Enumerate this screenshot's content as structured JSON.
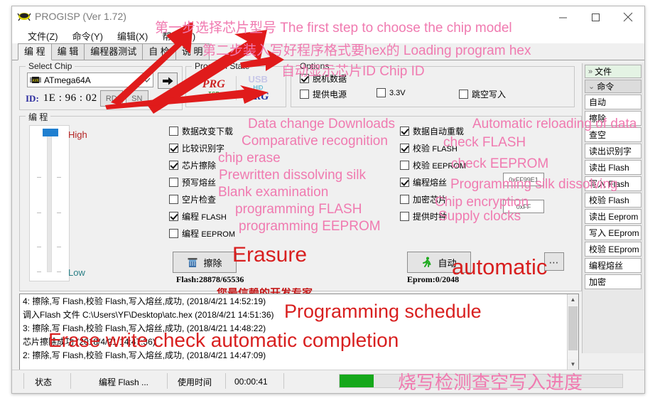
{
  "window": {
    "title": "PROGISP (Ver 1.72)",
    "minimize": "─",
    "maximize": "□",
    "close": "✕"
  },
  "menu": [
    "文件(Z)",
    "命令(Y)",
    "编辑(X)",
    "帮助(W)"
  ],
  "tabs": [
    {
      "label": "编  程",
      "active": true
    },
    {
      "label": "编  辑",
      "active": false
    },
    {
      "label": "编程器测试",
      "active": false
    },
    {
      "label": "自  检",
      "active": false
    },
    {
      "label": "说  明",
      "active": false
    }
  ],
  "select_chip": {
    "caption": "Select Chip",
    "chip": "ATmega64A",
    "dropdown_arrow": "⌄",
    "go_arrow": "➜",
    "id_label": "ID:",
    "id_value": "1E : 96 : 02",
    "rd_button": "RD",
    "sn_button": "SN"
  },
  "program_state": {
    "caption": "Program State",
    "left_main": "PRG",
    "left_sub": "ISP",
    "right_top": "USB",
    "right_mid": "HID",
    "right_main": "PRG"
  },
  "options": {
    "caption": "Options",
    "items": [
      {
        "label": "脱机数据",
        "checked": true
      },
      {
        "label": "提供电源",
        "checked": false
      },
      {
        "label": "3.3V",
        "checked": false
      },
      {
        "label": "跳空写入",
        "checked": false
      }
    ]
  },
  "programming": {
    "caption": "编  程",
    "slider_high": "High",
    "slider_low": "Low",
    "left_options": [
      {
        "label": "数据改变下载",
        "checked": false
      },
      {
        "label": "比较识别字",
        "checked": true
      },
      {
        "label": "芯片擦除",
        "checked": true
      },
      {
        "label": "预写熔丝",
        "checked": false
      },
      {
        "label": "空片检查",
        "checked": false
      },
      {
        "label": "编程 ",
        "suffix": "FLASH",
        "checked": true
      },
      {
        "label": "编程 ",
        "suffix": "EEPROM",
        "checked": false
      }
    ],
    "right_options": [
      {
        "label": "数据自动重载",
        "checked": true
      },
      {
        "label": "校验 ",
        "suffix": "FLASH",
        "checked": true
      },
      {
        "label": "校验 ",
        "suffix": "EEPROM",
        "checked": false
      },
      {
        "label": "编程熔丝",
        "checked": true
      },
      {
        "label": "加密芯片",
        "checked": false
      },
      {
        "label": "提供时钟",
        "checked": false
      }
    ],
    "fuse_value": "0xFF99E1",
    "lock_value": "0xFF",
    "erase_button": "擦除",
    "auto_button": "自动",
    "more_button": "⋯",
    "flash_usage": "Flash:28878/65536",
    "eprom_usage": "Eprom:0/2048",
    "banner": "您最信赖的开发专家"
  },
  "sidebar": {
    "file_header": "文件",
    "file_chevron": "»",
    "cmd_header": "命令",
    "cmd_chevron": "⌄",
    "buttons": [
      "自动",
      "擦除",
      "查空",
      "读出识别字",
      "读出 Flash",
      "写入 Flash",
      "校验 Flash",
      "读出 Eeprom",
      "写入 EEprom",
      "校验 EEprom",
      "编程熔丝",
      "加密"
    ]
  },
  "log": {
    "lines": [
      "4: 擦除,写 Flash,校验 Flash,写入熔丝,成功, (2018/4/21 14:52:19)",
      "调入Flash 文件 C:\\Users\\YF\\Desktop\\atc.hex (2018/4/21 14:51:36)",
      "3: 擦除,写 Flash,校验 Flash,写入熔丝,成功, (2018/4/21 14:48:22)",
      "芯片擦除成功 (2018/4/21 14:47:36)",
      "2: 擦除,写 Flash,校验 Flash,写入熔丝,成功, (2018/4/21 14:47:09)"
    ],
    "scroll_up": "▲",
    "scroll_down": "▼"
  },
  "statusbar": {
    "state_label": "状态",
    "state_value": "编程 Flash ...",
    "time_label": "使用时间",
    "time_value": "00:00:41",
    "progress_percent": 12
  },
  "annotations": [
    {
      "id": "a1",
      "text": "第一步选择芯片型号 The first step to choose the chip model",
      "color": "#f07ab0"
    },
    {
      "id": "a2",
      "text": "第二步装入写好程序格式要hex的 Loading program hex",
      "color": "#f07ab0"
    },
    {
      "id": "a3",
      "text": "自动显示芯片ID  Chip ID",
      "color": "#f07ab0"
    },
    {
      "id": "a4",
      "text": "Data change Downloads",
      "color": "#f07ab0"
    },
    {
      "id": "a5",
      "text": "Comparative recognition",
      "color": "#f07ab0"
    },
    {
      "id": "a6",
      "text": "chip erase",
      "color": "#f07ab0"
    },
    {
      "id": "a7",
      "text": "Prewritten dissolving silk",
      "color": "#f07ab0"
    },
    {
      "id": "a8",
      "text": "Blank examination",
      "color": "#f07ab0"
    },
    {
      "id": "a9",
      "text": "programming FLASH",
      "color": "#f07ab0"
    },
    {
      "id": "a10",
      "text": "programming EEPROM",
      "color": "#f07ab0"
    },
    {
      "id": "a11",
      "text": "Automatic reloading of data",
      "color": "#f07ab0"
    },
    {
      "id": "a12",
      "text": "check FLASH",
      "color": "#f07ab0"
    },
    {
      "id": "a13",
      "text": "check EEPROM",
      "color": "#f07ab0"
    },
    {
      "id": "a14",
      "text": "Programming silk dissolving",
      "color": "#f07ab0"
    },
    {
      "id": "a15",
      "text": "Chip encryption",
      "color": "#f07ab0"
    },
    {
      "id": "a16",
      "text": "Supply clocks",
      "color": "#f07ab0"
    },
    {
      "id": "a17",
      "text": "Erasure",
      "color": "#c62020"
    },
    {
      "id": "a18",
      "text": "automatic",
      "color": "#c62020"
    },
    {
      "id": "a19",
      "text": "Programming schedule",
      "color": "#c62020"
    },
    {
      "id": "a20",
      "text": "Erase write check automatic completion",
      "color": "#c62020"
    },
    {
      "id": "a21",
      "text": "烧写检测查空写入进度",
      "color": "#f07ab0"
    }
  ]
}
